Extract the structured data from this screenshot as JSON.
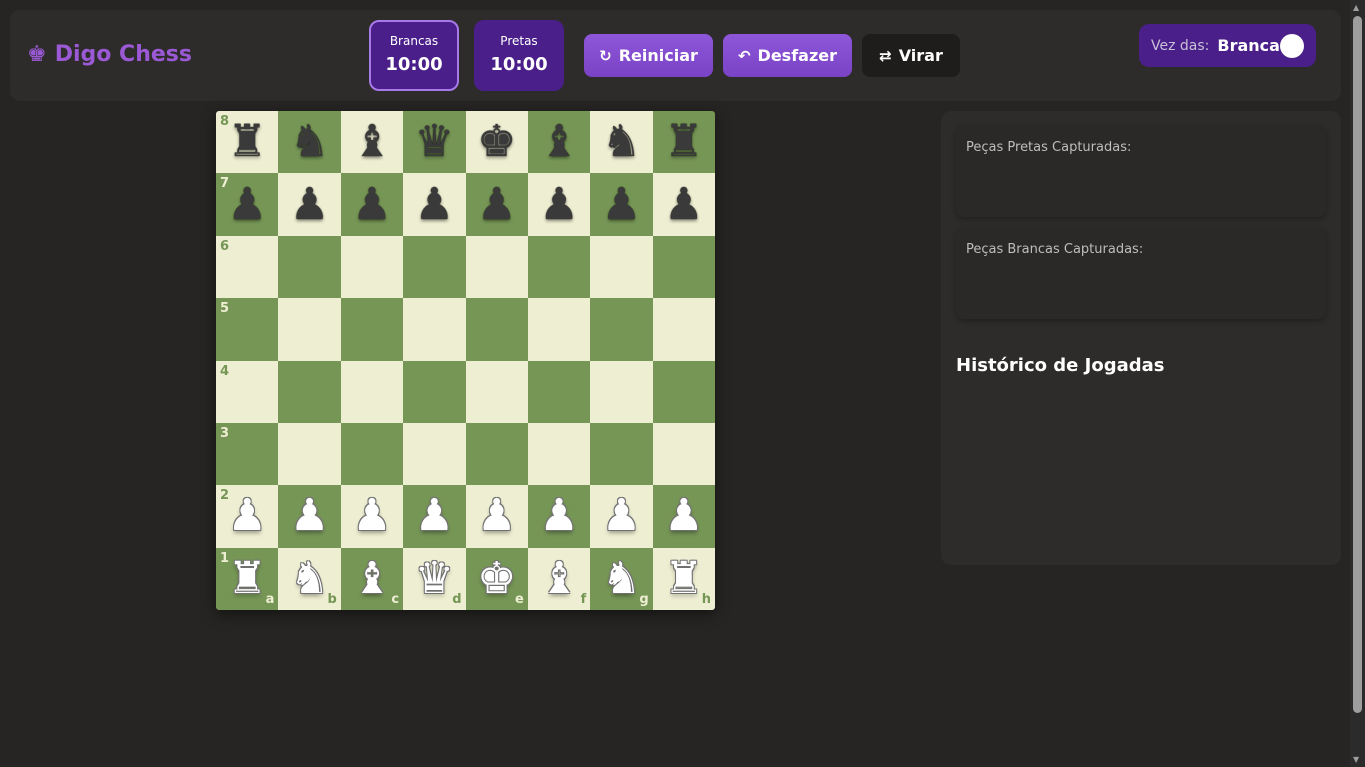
{
  "header": {
    "logo_icon": "♚",
    "title": "Digo Chess",
    "clocks": [
      {
        "label": "Brancas",
        "time": "10:00",
        "active": true
      },
      {
        "label": "Pretas",
        "time": "10:00",
        "active": false
      }
    ],
    "buttons": {
      "restart": {
        "icon": "↻",
        "label": "Reiniciar"
      },
      "undo": {
        "icon": "↶",
        "label": "Desfazer"
      },
      "flip": {
        "icon": "⇄",
        "label": "Virar"
      }
    },
    "turn": {
      "label": "Vez das:",
      "value": "Brancas"
    }
  },
  "board": {
    "rows": [
      [
        "bR",
        "bN",
        "bB",
        "bQ",
        "bK",
        "bB",
        "bN",
        "bR"
      ],
      [
        "bP",
        "bP",
        "bP",
        "bP",
        "bP",
        "bP",
        "bP",
        "bP"
      ],
      [
        "",
        "",
        "",
        "",
        "",
        "",
        "",
        ""
      ],
      [
        "",
        "",
        "",
        "",
        "",
        "",
        "",
        ""
      ],
      [
        "",
        "",
        "",
        "",
        "",
        "",
        "",
        ""
      ],
      [
        "",
        "",
        "",
        "",
        "",
        "",
        "",
        ""
      ],
      [
        "wP",
        "wP",
        "wP",
        "wP",
        "wP",
        "wP",
        "wP",
        "wP"
      ],
      [
        "wR",
        "wN",
        "wB",
        "wQ",
        "wK",
        "wB",
        "wN",
        "wR"
      ]
    ],
    "rank_labels": [
      "8",
      "7",
      "6",
      "5",
      "4",
      "3",
      "2",
      "1"
    ],
    "file_labels": [
      "a",
      "b",
      "c",
      "d",
      "e",
      "f",
      "g",
      "h"
    ],
    "light_color": "#eeeed2",
    "dark_color": "#769656"
  },
  "sidebar": {
    "captured_black_title": "Peças Pretas Capturadas:",
    "captured_white_title": "Peças Brancas Capturadas:",
    "history_title": "Histórico de Jogadas"
  },
  "colors": {
    "accent": "#8e56d8",
    "clock_bg": "#4a1f8a",
    "background": "#262523"
  }
}
